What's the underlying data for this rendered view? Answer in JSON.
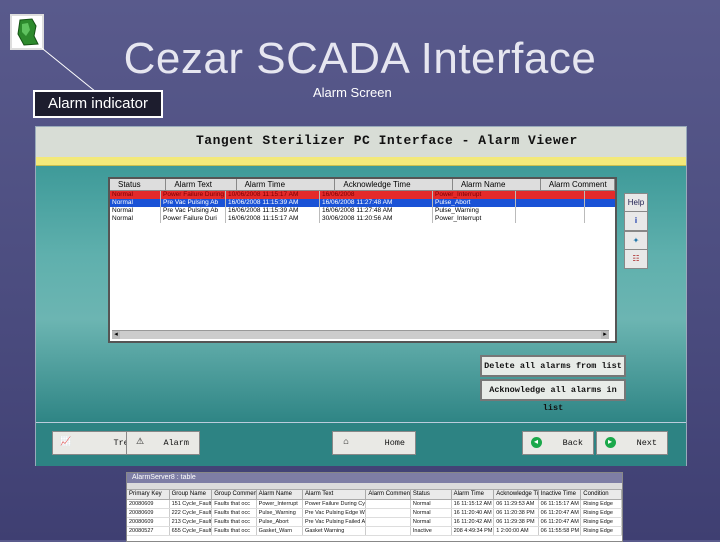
{
  "slide": {
    "title": "Cezar SCADA Interface",
    "alarm_indicator_label": "Alarm indicator",
    "alarm_screen_label": "Alarm Screen"
  },
  "app": {
    "title": "Tangent Sterilizer PC Interface - Alarm Viewer",
    "columns": [
      "Status",
      "Alarm Text",
      "Alarm Time",
      "Acknowledge Time",
      "Alarm Name",
      "Alarm Comment"
    ],
    "rows": [
      [
        "Normal",
        "Power Failure During",
        "10/06/2008 11:15:17 AM",
        "16/06/2008",
        "Power_Interrupt",
        ""
      ],
      [
        "Normal",
        "Pre Vac Pulsing Ab",
        "16/06/2008 11:15:39 AM",
        "16/06/2008 11:27:48 AM",
        "Pulse_Abort",
        ""
      ],
      [
        "Normal",
        "Pre Vac Pulsing Ab",
        "16/06/2008 11:15:39 AM",
        "16/06/2008 11:27:48 AM",
        "Pulse_Warning",
        ""
      ],
      [
        "Normal",
        "Power Failure Duri",
        "16/06/2008 11:15:17 AM",
        "30/06/2008 11:20:56 AM",
        "Power_Interrupt",
        ""
      ]
    ],
    "side_buttons": [
      "Help",
      "i",
      "✦",
      "☷"
    ],
    "delete_button": "Delete all alarms from list",
    "ack_button": "Acknowledge all alarms in list",
    "footer_buttons": {
      "trend": "Trend",
      "alarm": "Alarm",
      "home": "Home",
      "back": "Back",
      "next": "Next"
    }
  },
  "sub_window": {
    "title": "AlarmServer8 : table",
    "columns": [
      "Primary Key",
      "Group Name",
      "Group Comment",
      "Alarm Name",
      "Alarm Text",
      "Alarm Comment",
      "Status",
      "Alarm Time",
      "Acknowledge Time",
      "Inactive Time",
      "Condition"
    ],
    "rows": [
      [
        "20080609",
        "151 Cycle_Faults",
        "Faults that occ",
        "Power_Interrupt",
        "Power Failure During Cycle",
        "",
        "Normal",
        "16 11:15:12 AM",
        "06 11:29:53 AM",
        "06 11:15:17 AM",
        "Rising Edge"
      ],
      [
        "20080609",
        "222 Cycle_Faults",
        "Faults that occ",
        "Pulse_Warning",
        "Pre Vac Pulsing Edge Warn",
        "",
        "Normal",
        "16 11:20:40 AM",
        "06 11:20:38 PM",
        "06 11:20:47 AM",
        "Rising Edge"
      ],
      [
        "20080609",
        "213 Cycle_Faults",
        "Faults that occ",
        "Pulse_Abort",
        "Pre Vac Pulsing Failed Ab",
        "",
        "Normal",
        "16 11:20:42 AM",
        "06 11:29:38 PM",
        "06 11:20:47 AM",
        "Rising Edge"
      ],
      [
        "20080527",
        "655 Cycle_Faults",
        "Faults that occ",
        "Gasket_Warn",
        "Gasket Warning",
        "",
        "Inactive",
        "208 4:49:34 PM",
        "1 2:00:00 AM",
        "06 11:55:58 PM",
        "Rising Edge"
      ]
    ]
  }
}
